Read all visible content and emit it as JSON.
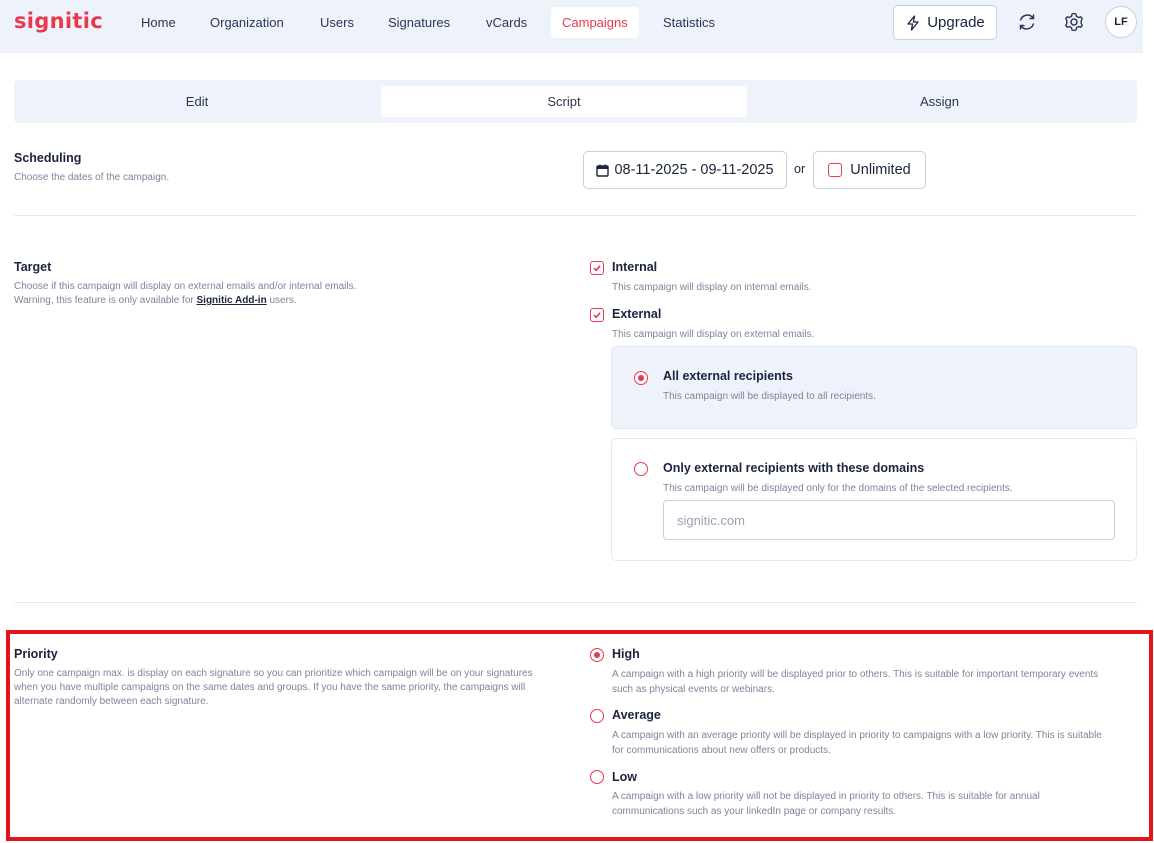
{
  "brand": {
    "logo": "signitic",
    "accent": "#e8394f"
  },
  "nav": {
    "items": [
      {
        "label": "Home",
        "active": false
      },
      {
        "label": "Organization",
        "active": false
      },
      {
        "label": "Users",
        "active": false
      },
      {
        "label": "Signatures",
        "active": false
      },
      {
        "label": "vCards",
        "active": false
      },
      {
        "label": "Campaigns",
        "active": true
      },
      {
        "label": "Statistics",
        "active": false
      }
    ],
    "upgrade_label": "Upgrade",
    "upgrade_icon": "lightning-icon",
    "refresh_icon": "refresh-icon",
    "settings_icon": "gear-icon",
    "avatar_initials": "LF"
  },
  "tabs": [
    {
      "label": "Edit",
      "active": false
    },
    {
      "label": "Script",
      "active": true
    },
    {
      "label": "Assign",
      "active": false
    }
  ],
  "scheduling": {
    "title": "Scheduling",
    "description": "Choose the dates of the campaign.",
    "date_range": "08-11-2025 - 09-11-2025",
    "date_icon": "calendar-icon",
    "or_text": "or",
    "unlimited_label": "Unlimited",
    "unlimited_checked": false
  },
  "target": {
    "title": "Target",
    "description_line1": "Choose if this campaign will display on external emails and/or internal emails.",
    "description_line2_prefix": "Warning, this feature is only available for ",
    "description_link": "Signitic Add-in",
    "description_line2_suffix": " users.",
    "internal": {
      "label": "Internal",
      "description": "This campaign will display on internal emails.",
      "checked": true
    },
    "external": {
      "label": "External",
      "description": "This campaign will display on external emails.",
      "checked": true
    },
    "all_recipients": {
      "label": "All external recipients",
      "description": "This campaign will be displayed to all recipients.",
      "selected": true
    },
    "domain_recipients": {
      "label": "Only external recipients with these domains",
      "description": "This campaign will be displayed only for the domains of the selected recipients.",
      "selected": false,
      "placeholder": "signitic.com"
    }
  },
  "priority": {
    "title": "Priority",
    "description_line1": "Only one campaign max. is display on each signature so you can prioritize which campaign will be on your signatures",
    "description_line2": "when you have multiple campaigns on the same dates and groups. If you have the same priority, the campaigns will",
    "description_line3": "alternate randomly between each signature.",
    "options": [
      {
        "label": "High",
        "line1": "A campaign with a high priority will be displayed prior to others. This is suitable for important temporary events",
        "line2": "such as physical events or webinars.",
        "selected": true
      },
      {
        "label": "Average",
        "line1": "A campaign with an average priority will be displayed in priority to campaigns with a low priority. This is suitable",
        "line2": "for communications about new offers or products.",
        "selected": false
      },
      {
        "label": "Low",
        "line1": "A campaign with a low priority will not be displayed in priority to others. This is suitable for annual",
        "line2": "communications such as your linkedIn page or company results.",
        "selected": false
      }
    ]
  }
}
